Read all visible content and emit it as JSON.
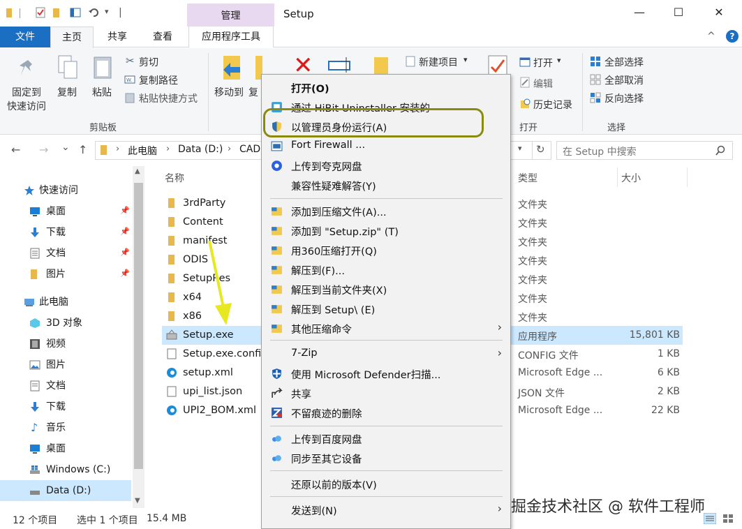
{
  "window": {
    "title": "Setup",
    "manage_tab": "管理",
    "minimize": "—",
    "maximize": "☐",
    "close": "✕"
  },
  "ribbon_tabs": {
    "file": "文件",
    "home": "主页",
    "share": "共享",
    "view": "查看",
    "app_tools": "应用程序工具",
    "collapse": "^",
    "help": "?"
  },
  "ribbon": {
    "pin": "固定到",
    "pin2": "快速访问",
    "copy": "复制",
    "paste": "粘贴",
    "cut": "剪切",
    "copy_path": "复制路径",
    "paste_shortcut": "粘贴快捷方式",
    "clipboard_group": "剪贴板",
    "move_to": "移动到",
    "copy_to": "复",
    "new_item": "新建项目",
    "open": "打开",
    "edit": "编辑",
    "history": "历史记录",
    "open_group": "打开",
    "select_all": "全部选择",
    "select_none": "全部取消",
    "invert": "反向选择",
    "select_group": "选择",
    "dropdown": "▾"
  },
  "address": {
    "crumb1": "此电脑",
    "crumb2": "Data (D:)",
    "crumb3": "CAD",
    "sep": "›",
    "search_placeholder": "在 Setup 中搜索",
    "back": "←",
    "forward": "→",
    "recent": "⌄",
    "up": "↑"
  },
  "nav": {
    "quick_access": "快速访问",
    "desktop": "桌面",
    "downloads": "下载",
    "documents": "文档",
    "pictures": "图片",
    "this_pc": "此电脑",
    "objects3d": "3D 对象",
    "videos": "视频",
    "pictures2": "图片",
    "documents2": "文档",
    "downloads2": "下载",
    "music": "音乐",
    "desktop2": "桌面",
    "drive_c": "Windows (C:)",
    "drive_d": "Data (D:)"
  },
  "columns": {
    "name": "名称",
    "type": "类型",
    "size": "大小"
  },
  "files": [
    {
      "name": "3rdParty",
      "type": "文件夹",
      "size": ""
    },
    {
      "name": "Content",
      "type": "文件夹",
      "size": ""
    },
    {
      "name": "manifest",
      "type": "文件夹",
      "size": ""
    },
    {
      "name": "ODIS",
      "type": "文件夹",
      "size": ""
    },
    {
      "name": "SetupRes",
      "type": "文件夹",
      "size": ""
    },
    {
      "name": "x64",
      "type": "文件夹",
      "size": ""
    },
    {
      "name": "x86",
      "type": "文件夹",
      "size": ""
    },
    {
      "name": "Setup.exe",
      "type": "应用程序",
      "size": "15,801 KB"
    },
    {
      "name": "Setup.exe.config",
      "type": "CONFIG 文件",
      "size": "1 KB"
    },
    {
      "name": "setup.xml",
      "type": "Microsoft Edge ...",
      "size": "6 KB"
    },
    {
      "name": "upi_list.json",
      "type": "JSON 文件",
      "size": "2 KB"
    },
    {
      "name": "UPI2_BOM.xml",
      "type": "Microsoft Edge ...",
      "size": "22 KB"
    }
  ],
  "context_menu": {
    "open": "打开(O)",
    "hibit": "通过 HiBit Uninstaller 安装的",
    "run_admin": "以管理员身份运行(A)",
    "fort": "Fort Firewall ...",
    "quark": "上传到夸克网盘",
    "compat": "兼容性疑难解答(Y)",
    "add_archive": "添加到压缩文件(A)...",
    "add_zip": "添加到 \"Setup.zip\" (T)",
    "open360": "用360压缩打开(Q)",
    "extract_to": "解压到(F)...",
    "extract_here": "解压到当前文件夹(X)",
    "extract_setup": "解压到 Setup\\ (E)",
    "other_cmd": "其他压缩命令",
    "zip7": "7-Zip",
    "defender": "使用 Microsoft Defender扫描...",
    "share": "共享",
    "shred": "不留痕迹的删除",
    "baidu": "上传到百度网盘",
    "sync": "同步至其它设备",
    "restore": "还原以前的版本(V)",
    "send_to": "发送到(N)",
    "submenu_arrow": "›"
  },
  "status": {
    "count": "12 个项目",
    "selected": "选中 1 个项目",
    "size": "15.4 MB"
  },
  "watermark": "掘金技术社区 @ 软件工程师",
  "colors": {
    "file_tab": "#1a6fc2",
    "manage_tab": "#e8d8f0",
    "selection": "#cce8ff",
    "folder": "#e8b84a",
    "highlight_ring": "#8a8a10",
    "arrow": "#e8e820"
  }
}
